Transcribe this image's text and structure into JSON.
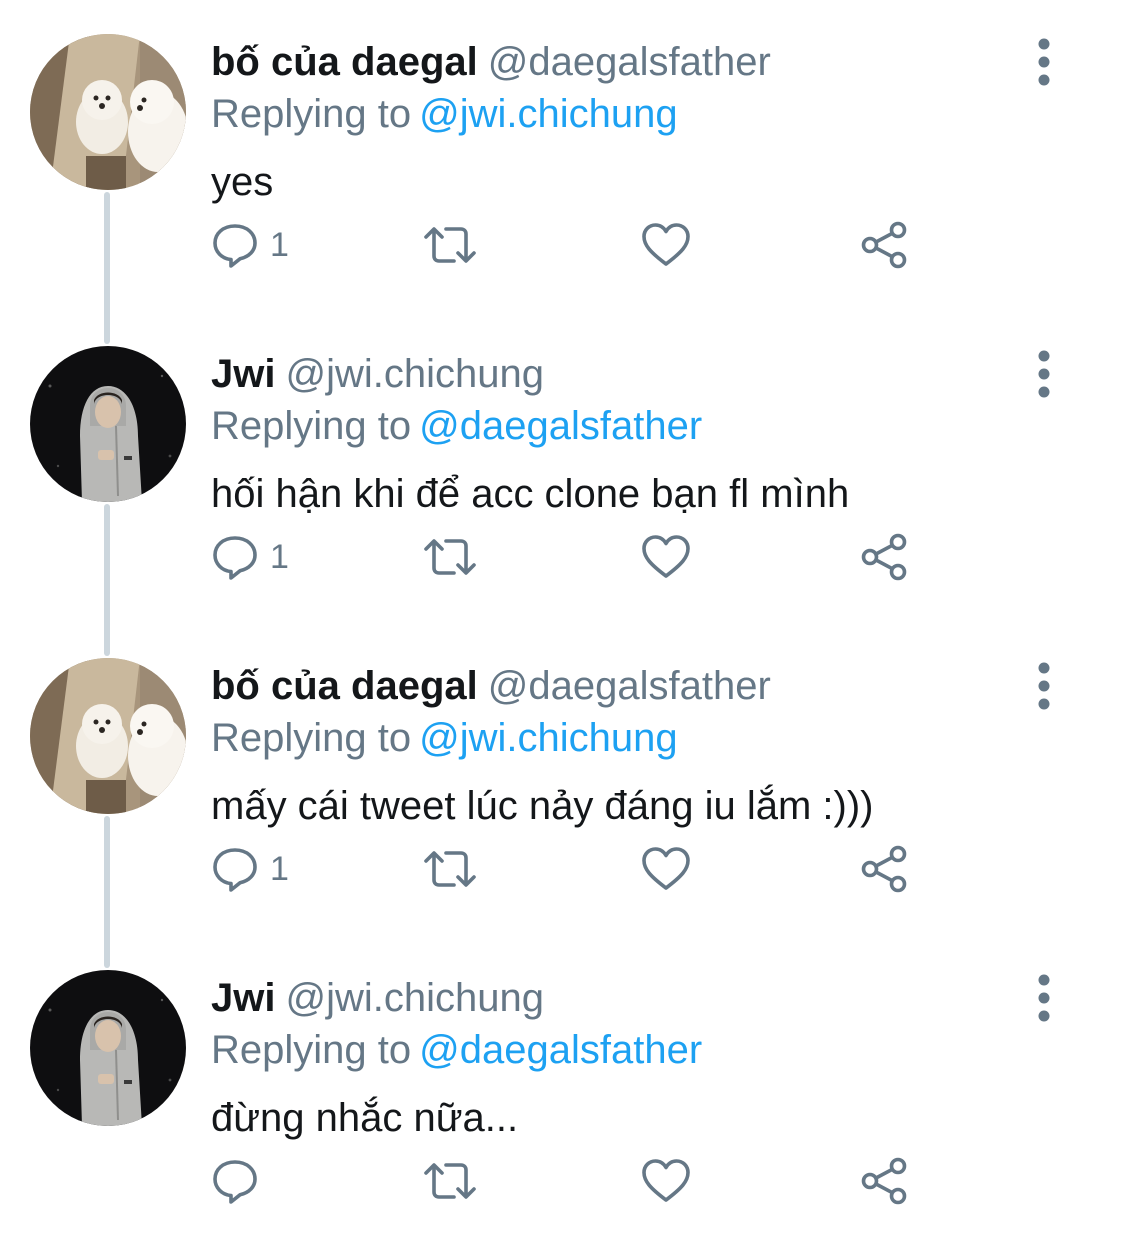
{
  "thread": {
    "tweets": [
      {
        "display_name": "bố của daegal",
        "handle": "@daegalsfather",
        "replying_label": "Replying to",
        "replying_to": "@jwi.chichung",
        "text": "yes",
        "reply_count": "1",
        "avatar": "dogs-avatar"
      },
      {
        "display_name": "Jwi",
        "handle": "@jwi.chichung",
        "replying_label": "Replying to",
        "replying_to": "@daegalsfather",
        "text": "hối hận khi để acc clone bạn fl mình",
        "reply_count": "1",
        "avatar": "hoodie-person-avatar"
      },
      {
        "display_name": "bố của daegal",
        "handle": "@daegalsfather",
        "replying_label": "Replying to",
        "replying_to": "@jwi.chichung",
        "text": "mấy cái tweet lúc nảy đáng iu lắm :)))",
        "reply_count": "1",
        "avatar": "dogs-avatar"
      },
      {
        "display_name": "Jwi",
        "handle": "@jwi.chichung",
        "replying_label": "Replying to",
        "replying_to": "@daegalsfather",
        "text": "đừng nhắc nữa...",
        "reply_count": "",
        "avatar": "hoodie-person-avatar"
      }
    ]
  },
  "icons": {
    "reply": "reply-icon",
    "retweet": "retweet-icon",
    "like": "heart-icon",
    "share": "share-icon",
    "more": "more-vertical-icon"
  },
  "colors": {
    "name": "#14171a",
    "secondary": "#657786",
    "link": "#1da1f2",
    "thread_line": "#ccd6dd",
    "icon": "#657786"
  }
}
